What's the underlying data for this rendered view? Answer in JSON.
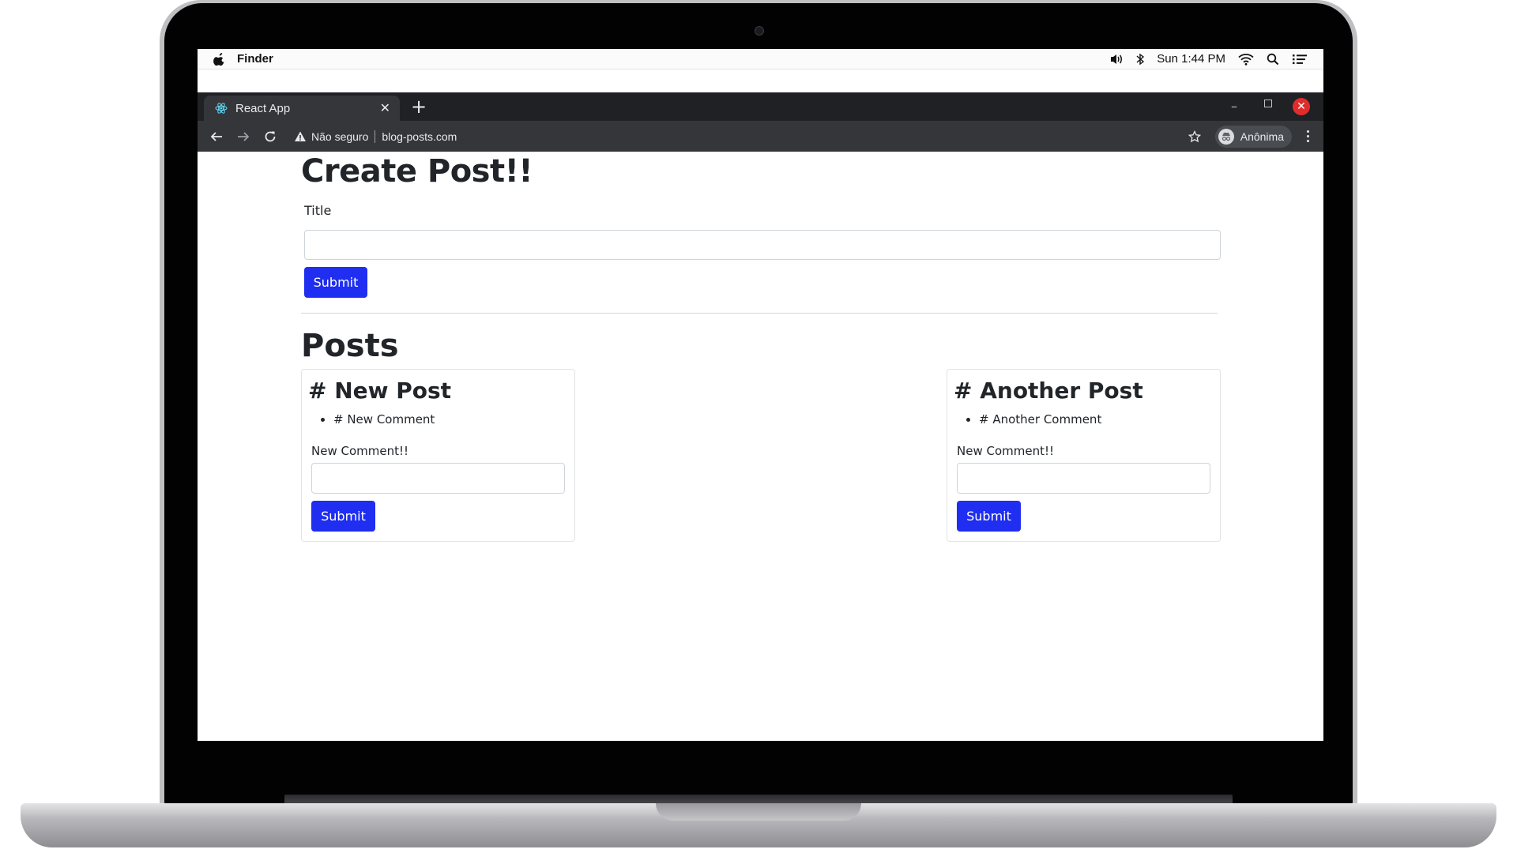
{
  "menubar": {
    "app_name": "Finder",
    "clock": "Sun 1:44 PM"
  },
  "browser": {
    "tab_title": "React App",
    "tab_close": "✕",
    "new_tab": "+",
    "window_minimize": "–",
    "window_close": "✕",
    "not_secure_label": "Não seguro",
    "url": "blog-posts.com",
    "profile_label": "Anônima"
  },
  "page": {
    "create_heading": "Create Post!!",
    "title_label": "Title",
    "title_value": "",
    "submit_label": "Submit",
    "posts_heading": "Posts",
    "posts": [
      {
        "title": "# New Post",
        "comments": [
          "# New Comment"
        ],
        "comment_label": "New Comment!!",
        "comment_value": "",
        "submit_label": "Submit"
      },
      {
        "title": "# Another Post",
        "comments": [
          "# Another Comment"
        ],
        "comment_label": "New Comment!!",
        "comment_value": "",
        "submit_label": "Submit"
      }
    ]
  },
  "colors": {
    "button_blue": "#1f2ef0",
    "close_red": "#e22c2c",
    "tab_strip": "#202124",
    "toolbar": "#35363a"
  }
}
